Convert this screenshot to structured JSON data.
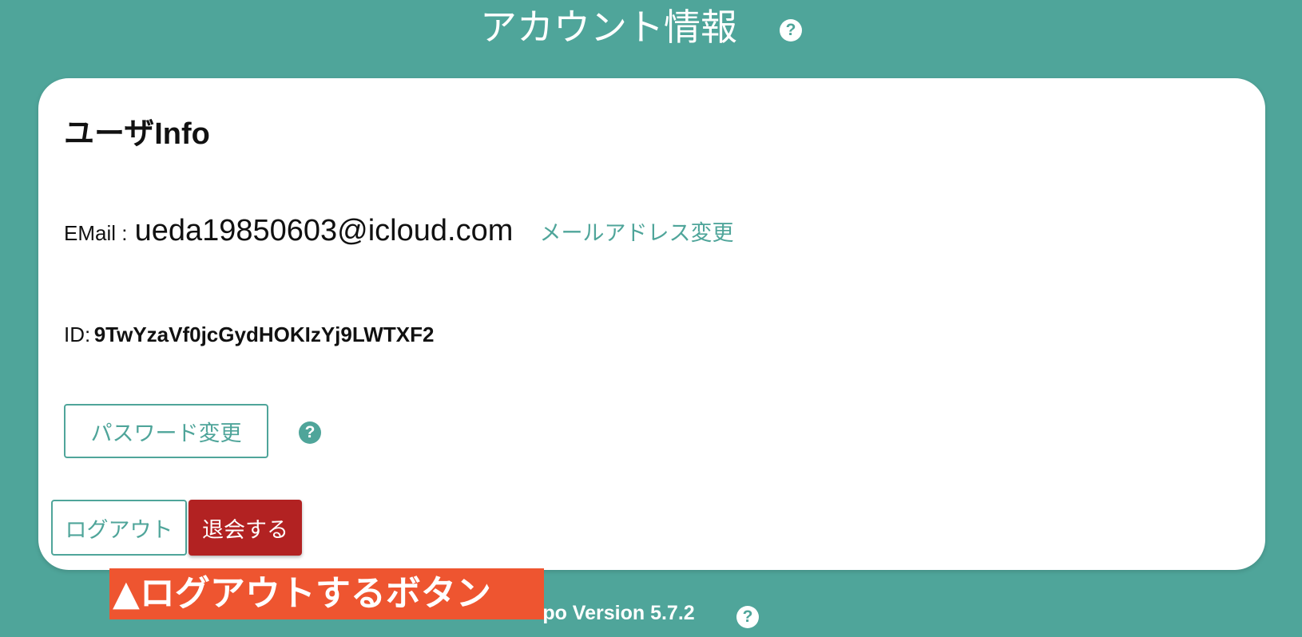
{
  "header": {
    "title": "アカウント情報",
    "help_icon": "question-circle-icon"
  },
  "card": {
    "heading": "ユーザInfo",
    "email": {
      "label": "EMail :",
      "value": "ueda19850603@icloud.com",
      "change_link": "メールアドレス変更"
    },
    "id": {
      "label": "ID:",
      "value": "9TwYzaVf0jcGydHOKIzYj9LWTXF2"
    },
    "password_button": "パスワード変更",
    "password_help_icon": "question-circle-icon",
    "logout_button": "ログアウト",
    "withdraw_button": "退会する"
  },
  "footer": {
    "version": "Kipo Version 5.7.2",
    "help_icon": "question-circle-icon"
  },
  "annotation": {
    "text": "▲ログアウトするボタン"
  },
  "colors": {
    "background": "#4fa59a",
    "accent": "#4fa59a",
    "danger": "#b22222",
    "annotation": "#ee5530"
  }
}
